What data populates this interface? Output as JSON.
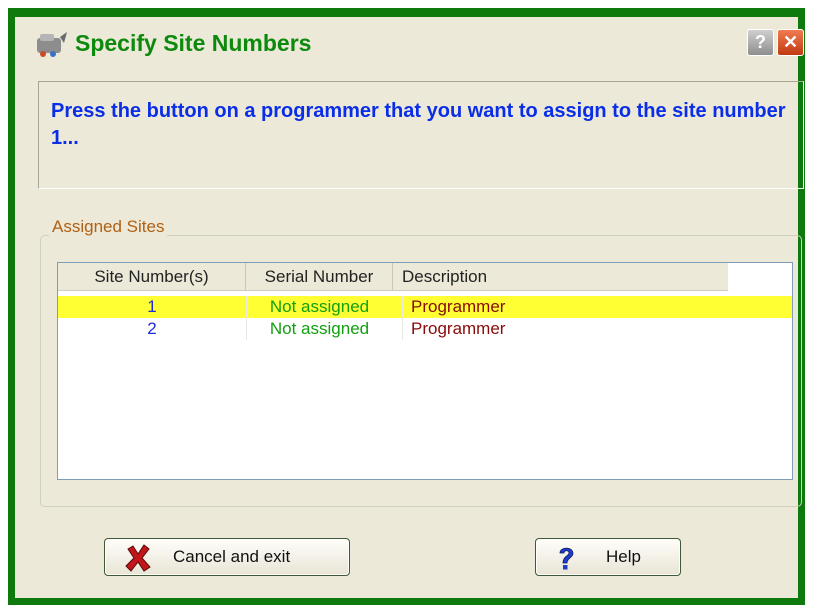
{
  "window": {
    "title": "Specify Site Numbers",
    "help_glyph": "?",
    "close_glyph": "✕",
    "accent_color": "#0e7a0e"
  },
  "message": "Press the button on a programmer that you want to assign to the site number 1...",
  "assigned_sites": {
    "group_label": "Assigned Sites",
    "columns": [
      "Site Number(s)",
      "Serial Number",
      "Description"
    ],
    "rows": [
      {
        "site": "1",
        "serial": "Not assigned",
        "description": "Programmer",
        "selected": true
      },
      {
        "site": "2",
        "serial": "Not assigned",
        "description": "Programmer",
        "selected": false
      }
    ]
  },
  "buttons": {
    "cancel_label": "Cancel and exit",
    "cancel_icon": "red-x-icon",
    "help_label": "Help",
    "help_icon": "blue-question-icon"
  }
}
